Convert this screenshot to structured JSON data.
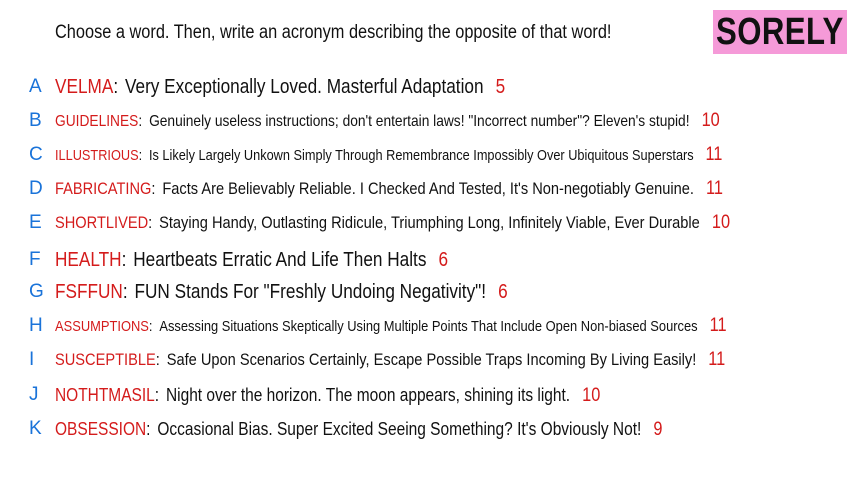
{
  "instruction": "Choose a word. Then, write an acronym describing the opposite of that word!",
  "title": "SORELY",
  "colors": {
    "letter": "#1a73d9",
    "word": "#d41b1b",
    "badge": "#f59ad8"
  },
  "rows": [
    {
      "letter": "A",
      "word": "VELMA",
      "colon": ":",
      "acronym": "Very Exceptionally Loved. Masterful Adaptation",
      "count": "5"
    },
    {
      "letter": "B",
      "word": "GUIDELINES",
      "colon": ":",
      "acronym": "Genuinely useless instructions; don't entertain laws! \"Incorrect number\"? Eleven's stupid!",
      "count": "10"
    },
    {
      "letter": "C",
      "word": "ILLUSTRIOUS",
      "colon": ":",
      "acronym": "Is Likely Largely Unkown Simply Through Remembrance Impossibly Over Ubiquitous Superstars",
      "count": "11"
    },
    {
      "letter": "D",
      "word": "FABRICATING",
      "colon": ":",
      "acronym": "Facts Are Believably Reliable. I Checked And Tested, It's Non-negotiably Genuine.",
      "count": "11"
    },
    {
      "letter": "E",
      "word": "SHORTLIVED",
      "colon": ":",
      "acronym": "Staying Handy, Outlasting Ridicule, Triumphing Long, Infinitely Viable, Ever Durable",
      "count": "10"
    },
    {
      "letter": "F",
      "word": "HEALTH",
      "colon": ":",
      "acronym": "Heartbeats Erratic And Life Then Halts",
      "count": "6"
    },
    {
      "letter": "G",
      "word": "FSFFUN",
      "colon": ":",
      "acronym": "FUN Stands For \"Freshly Undoing Negativity\"!",
      "count": "6"
    },
    {
      "letter": "H",
      "word": "ASSUMPTIONS",
      "colon": ":",
      "acronym": "Assessing Situations Skeptically Using Multiple Points That Include Open Non-biased Sources",
      "count": "11"
    },
    {
      "letter": "I",
      "word": "SUSCEPTIBLE",
      "colon": ":",
      "acronym": "Safe Upon Scenarios Certainly, Escape Possible Traps Incoming By Living Easily!",
      "count": "11"
    },
    {
      "letter": "J",
      "word": "NOTHTMASIL",
      "colon": ":",
      "acronym": "Night over the horizon. The moon appears, shining its light.",
      "count": "10"
    },
    {
      "letter": "K",
      "word": "OBSESSION",
      "colon": ":",
      "acronym": "Occasional Bias. Super Excited Seeing Something? It's Obviously Not!",
      "count": "9"
    }
  ]
}
